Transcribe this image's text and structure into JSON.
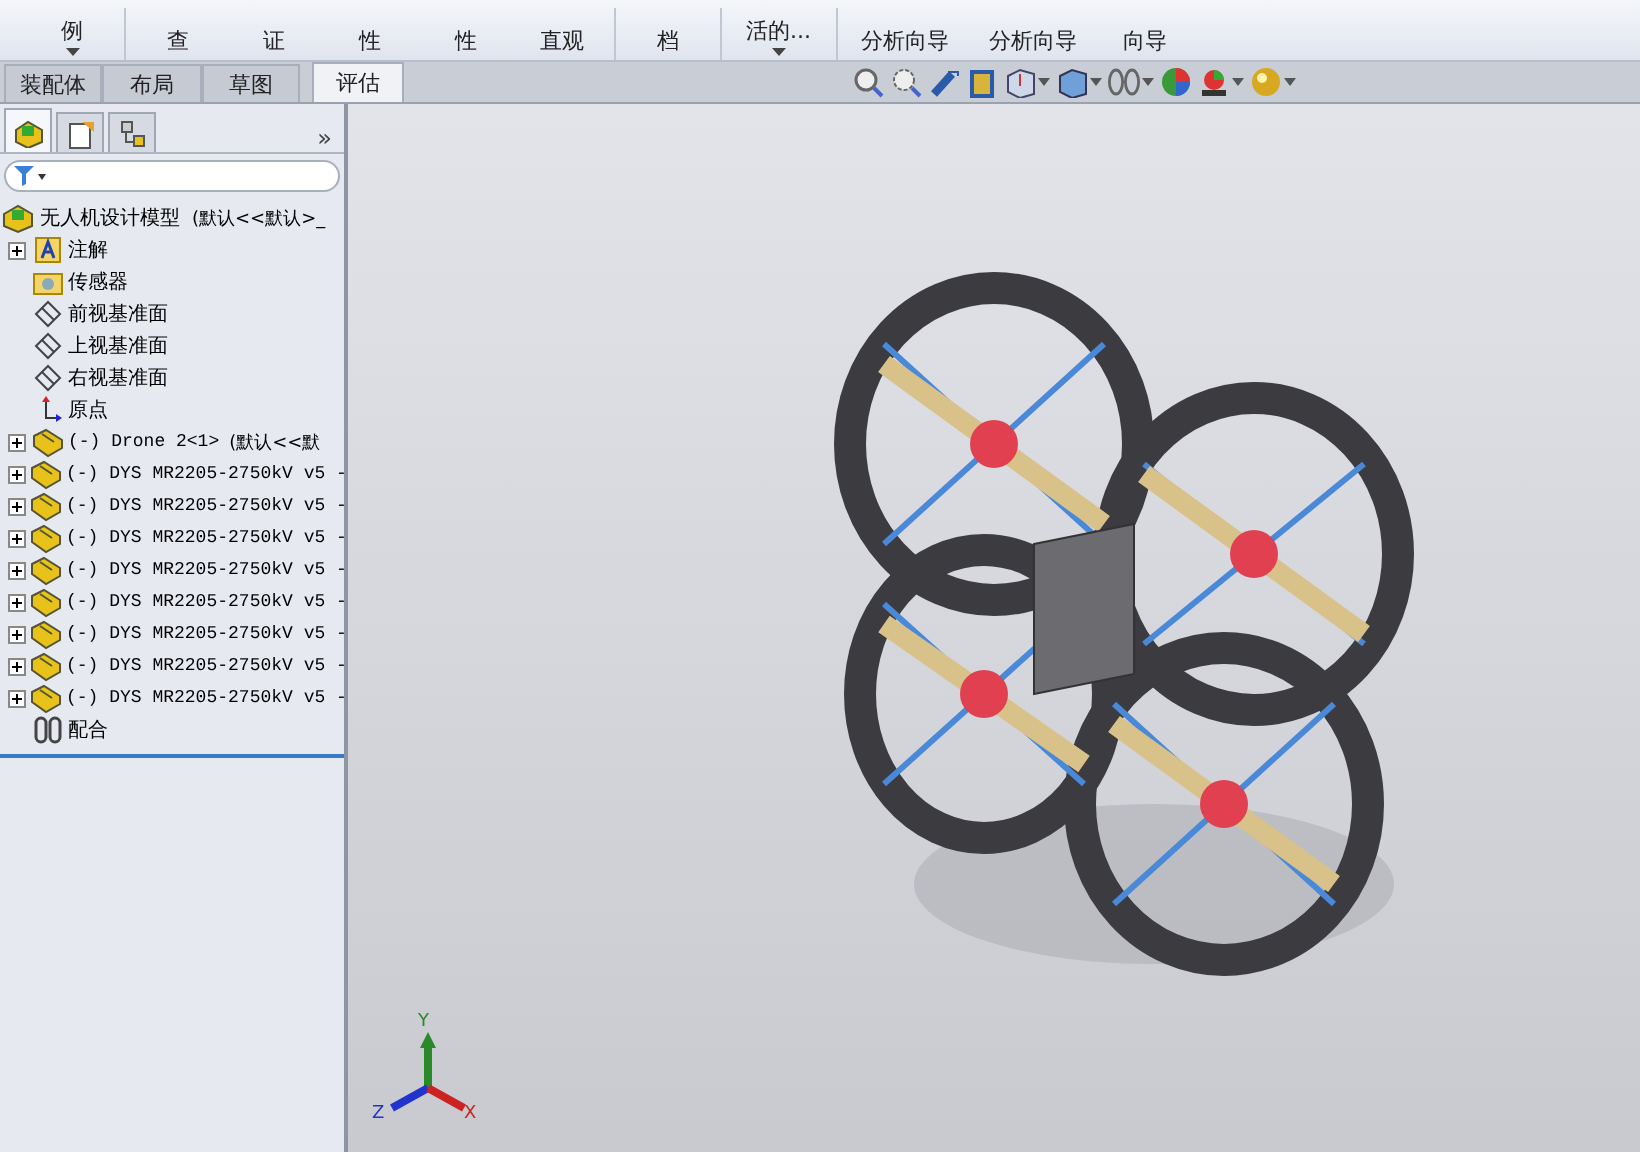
{
  "ribbon": {
    "buttons": [
      {
        "label": "例",
        "dropdown": true
      },
      {
        "label": "查",
        "dropdown": false
      },
      {
        "label": "证",
        "dropdown": false
      },
      {
        "label": "性",
        "dropdown": false
      },
      {
        "label": "性",
        "dropdown": false
      },
      {
        "label": "直观",
        "dropdown": false
      },
      {
        "label": "档",
        "dropdown": false
      },
      {
        "label": "活的...",
        "dropdown": true
      },
      {
        "label": "分析向导",
        "dropdown": false
      },
      {
        "label": "分析向导",
        "dropdown": false
      },
      {
        "label": "向导",
        "dropdown": false
      }
    ]
  },
  "tabs": [
    {
      "label": "装配体",
      "selected": false
    },
    {
      "label": "布局",
      "selected": false
    },
    {
      "label": "草图",
      "selected": false
    },
    {
      "label": "评估",
      "selected": true
    }
  ],
  "view_toolbar": [
    {
      "kind": "zoom-fit",
      "dropdown": false
    },
    {
      "kind": "zoom-area",
      "dropdown": false
    },
    {
      "kind": "previous-view",
      "dropdown": false
    },
    {
      "kind": "section",
      "dropdown": false
    },
    {
      "kind": "view-orientation",
      "dropdown": true
    },
    {
      "kind": "display-style",
      "dropdown": true
    },
    {
      "kind": "hide-show",
      "dropdown": true
    },
    {
      "kind": "appearance",
      "dropdown": false
    },
    {
      "kind": "scene",
      "dropdown": true
    },
    {
      "kind": "render",
      "dropdown": true
    }
  ],
  "panel_tabs": [
    {
      "kind": "feature-tree",
      "selected": true
    },
    {
      "kind": "property",
      "selected": false
    },
    {
      "kind": "configuration",
      "selected": false
    }
  ],
  "panel_more": "»",
  "tree": {
    "name": "无人机设计模型",
    "config": "(默认<<默认>_",
    "children": [
      {
        "kind": "annotations",
        "name": "注解",
        "expandable": true
      },
      {
        "kind": "sensors",
        "name": "传感器",
        "expandable": false
      },
      {
        "kind": "plane",
        "name": "前视基准面",
        "expandable": false
      },
      {
        "kind": "plane",
        "name": "上视基准面",
        "expandable": false
      },
      {
        "kind": "plane",
        "name": "右视基准面",
        "expandable": false
      },
      {
        "kind": "origin",
        "name": "原点",
        "expandable": false
      },
      {
        "kind": "part",
        "name": "(-) Drone 2<1>",
        "config": "(默认<<默",
        "expandable": true
      },
      {
        "kind": "part",
        "name": "(-) DYS MR2205-2750kV v5 -",
        "expandable": true
      },
      {
        "kind": "part",
        "name": "(-) DYS MR2205-2750kV v5 -",
        "expandable": true
      },
      {
        "kind": "part",
        "name": "(-) DYS MR2205-2750kV v5 -",
        "expandable": true
      },
      {
        "kind": "part",
        "name": "(-) DYS MR2205-2750kV v5 -",
        "expandable": true
      },
      {
        "kind": "part",
        "name": "(-) DYS MR2205-2750kV v5 -",
        "expandable": true
      },
      {
        "kind": "part",
        "name": "(-) DYS MR2205-2750kV v5 -",
        "expandable": true
      },
      {
        "kind": "part",
        "name": "(-) DYS MR2205-2750kV v5 -",
        "expandable": true
      },
      {
        "kind": "part",
        "name": "(-) DYS MR2205-2750kV v5 -",
        "expandable": true
      },
      {
        "kind": "mates",
        "name": "配合",
        "expandable": false
      }
    ]
  },
  "triad": {
    "x": "X",
    "y": "Y",
    "z": "Z"
  }
}
